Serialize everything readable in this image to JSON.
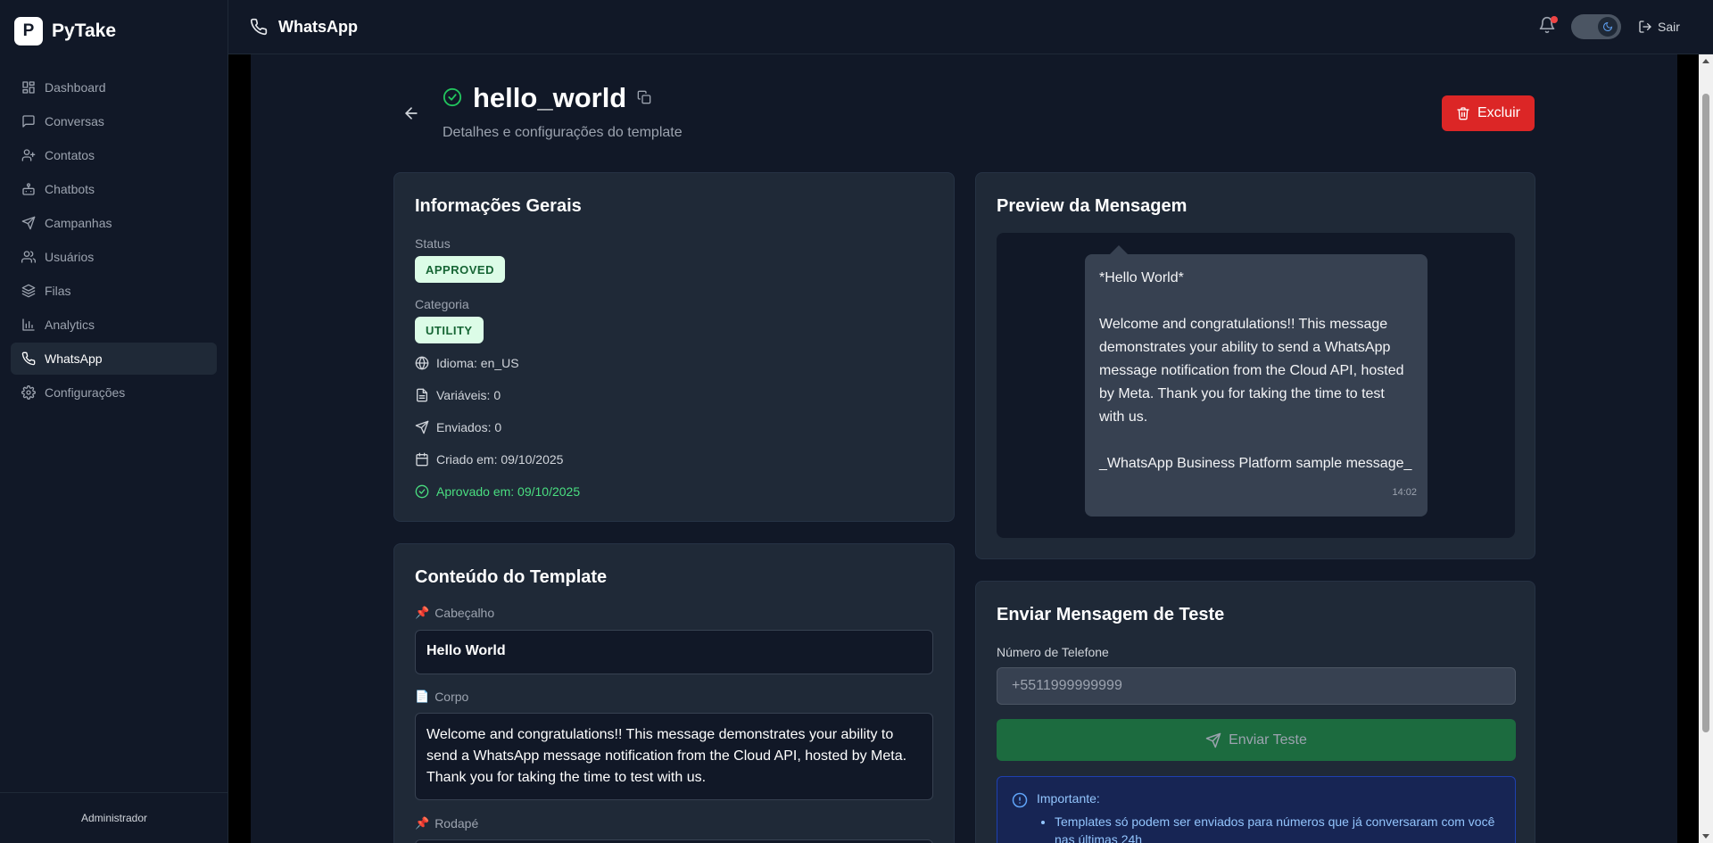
{
  "brand": {
    "logo_letter": "P",
    "name": "PyTake"
  },
  "sidebar": {
    "items": [
      {
        "label": "Dashboard",
        "icon": "dashboard-icon"
      },
      {
        "label": "Conversas",
        "icon": "message-square-icon"
      },
      {
        "label": "Contatos",
        "icon": "user-plus-icon"
      },
      {
        "label": "Chatbots",
        "icon": "bot-icon"
      },
      {
        "label": "Campanhas",
        "icon": "send-icon"
      },
      {
        "label": "Usuários",
        "icon": "users-icon"
      },
      {
        "label": "Filas",
        "icon": "layers-icon"
      },
      {
        "label": "Analytics",
        "icon": "bar-chart-icon"
      },
      {
        "label": "WhatsApp",
        "icon": "phone-icon",
        "active": true
      },
      {
        "label": "Configurações",
        "icon": "settings-icon"
      }
    ],
    "footer_user": "Administrador"
  },
  "topbar": {
    "title": "WhatsApp",
    "logout_label": "Sair"
  },
  "page": {
    "title": "hello_world",
    "subtitle": "Detalhes e configurações do template",
    "delete_label": "Excluir"
  },
  "info": {
    "title": "Informações Gerais",
    "status_label": "Status",
    "status_value": "APPROVED",
    "category_label": "Categoria",
    "category_value": "UTILITY",
    "language": "Idioma: en_US",
    "variables": "Variáveis: 0",
    "sent": "Enviados: 0",
    "created": "Criado em: 09/10/2025",
    "approved": "Aprovado em: 09/10/2025"
  },
  "content": {
    "title": "Conteúdo do Template",
    "header_label": "Cabeçalho",
    "header_emoji": "📌",
    "header_value": "Hello World",
    "body_label": "Corpo",
    "body_emoji": "📄",
    "body_value": "Welcome and congratulations!! This message demonstrates your ability to send a WhatsApp message notification from the Cloud API, hosted by Meta. Thank you for taking the time to test with us.",
    "footer_label": "Rodapé",
    "footer_emoji": "📌"
  },
  "preview": {
    "title": "Preview da Mensagem",
    "lines": [
      "*Hello World*",
      "",
      "Welcome and congratulations!! This message demonstrates your ability to send a WhatsApp message notification from the Cloud API, hosted by Meta. Thank you for taking the time to test with us.",
      "",
      "_WhatsApp Business Platform sample message_"
    ],
    "time": "14:02"
  },
  "test": {
    "title": "Enviar Mensagem de Teste",
    "phone_label": "Número de Telefone",
    "phone_placeholder": "+5511999999999",
    "send_label": "Enviar Teste",
    "notice_title": "Importante:",
    "notice_items": [
      "Templates só podem ser enviados para números que já conversaram com você nas últimas 24h"
    ]
  },
  "colors": {
    "accent_red": "#dc2626",
    "success_green": "#22c55e",
    "send_button": "#1c6b3f",
    "notice_blue": "#172554"
  }
}
